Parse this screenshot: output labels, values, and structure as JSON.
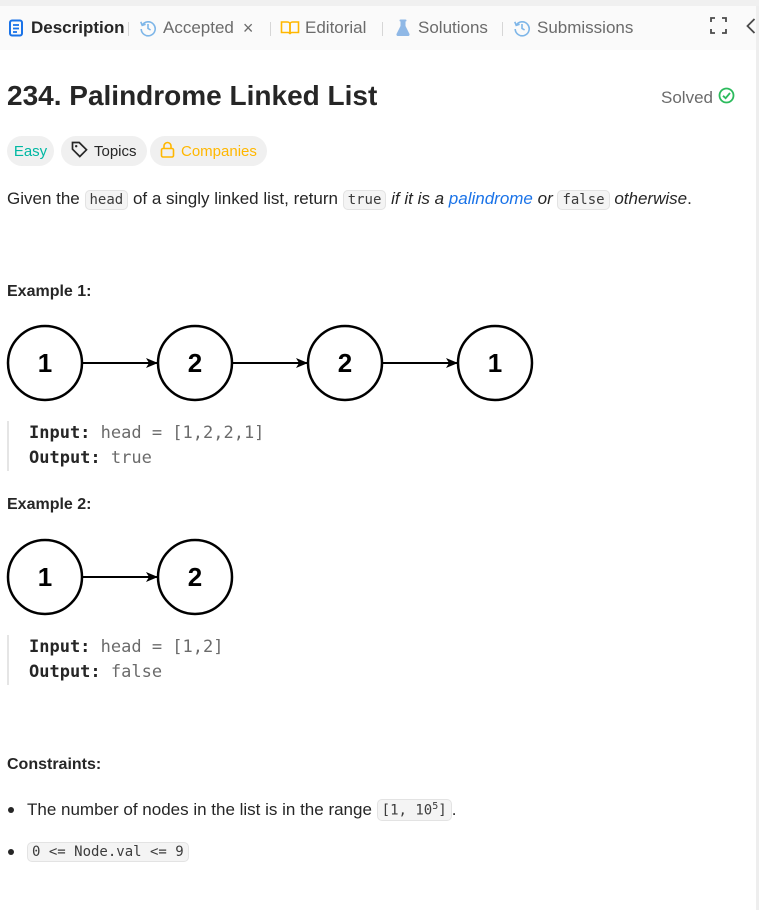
{
  "tabs": {
    "description": "Description",
    "accepted": "Accepted",
    "accepted_close": "×",
    "editorial": "Editorial",
    "solutions": "Solutions",
    "submissions": "Submissions"
  },
  "problem": {
    "title": "234. Palindrome Linked List",
    "status": "Solved",
    "tags": {
      "difficulty": "Easy",
      "topics": "Topics",
      "companies": "Companies"
    }
  },
  "description": {
    "p1": "Given the ",
    "code_head": "head",
    "p2": " of a singly linked list, return ",
    "code_true": "true",
    "em1": " if it is a ",
    "link": "palindrome",
    "em2": " or ",
    "code_false": "false",
    "em3": " otherwise",
    "end": "."
  },
  "example1": {
    "heading": "Example 1:",
    "nodes": [
      "1",
      "2",
      "2",
      "1"
    ],
    "input_label": "Input:",
    "input_value": " head = [1,2,2,1]",
    "output_label": "Output:",
    "output_value": " true"
  },
  "example2": {
    "heading": "Example 2:",
    "nodes": [
      "1",
      "2"
    ],
    "input_label": "Input:",
    "input_value": " head = [1,2]",
    "output_label": "Output:",
    "output_value": " false"
  },
  "constraints": {
    "heading": "Constraints:",
    "c1_text": "The number of nodes in the list is in the range ",
    "c1_code": "[1, 10",
    "c1_sup": "5",
    "c1_code_end": "]",
    "c1_end": ".",
    "c2_code": "0 <= Node.val <= 9"
  },
  "colors": {
    "easy": "#00b8a3",
    "companies": "#ffb700",
    "solved_check": "#2cbb5d",
    "link": "#1a73e8",
    "description_tab_icon": "#1a73e8"
  },
  "icons": {
    "description": "document-icon",
    "accepted": "history-clock-icon",
    "editorial": "book-icon",
    "solutions": "flask-icon",
    "submissions": "history-clock-icon",
    "expand": "fullscreen-icon",
    "collapse": "chevron-left-icon",
    "topics": "tag-icon",
    "companies": "lock-icon",
    "solved": "check-circle-icon"
  }
}
